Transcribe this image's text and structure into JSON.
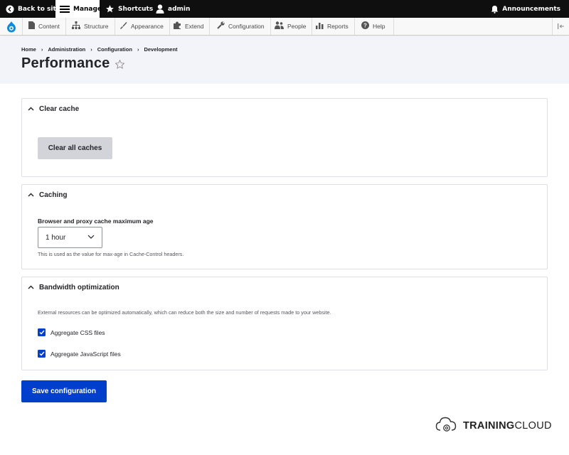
{
  "toolbar": {
    "back_to_site": "Back to site",
    "manage": "Manage",
    "shortcuts": "Shortcuts",
    "user": "admin",
    "announcements": "Announcements"
  },
  "admin_menu": {
    "content": "Content",
    "structure": "Structure",
    "appearance": "Appearance",
    "extend": "Extend",
    "configuration": "Configuration",
    "people": "People",
    "reports": "Reports",
    "help": "Help"
  },
  "breadcrumb": {
    "home": "Home",
    "administration": "Administration",
    "configuration": "Configuration",
    "development": "Development"
  },
  "page_title": "Performance",
  "clear_cache": {
    "heading": "Clear cache",
    "button": "Clear all caches"
  },
  "caching": {
    "heading": "Caching",
    "label": "Browser and proxy cache maximum age",
    "selected": "1 hour",
    "description": "This is used as the value for max-age in Cache-Control headers."
  },
  "bandwidth": {
    "heading": "Bandwidth optimization",
    "description": "External resources can be optimized automatically, which can reduce both the size and number of requests made to your website.",
    "css_label": "Aggregate CSS files",
    "css_checked": true,
    "js_label": "Aggregate JavaScript files",
    "js_checked": true
  },
  "save_button": "Save configuration",
  "brand": {
    "part1": "TRAINING",
    "part2": "CLOUD"
  },
  "colors": {
    "accent": "#003ecc",
    "toolbar": "#0f0f0f",
    "header_bg": "#f3f4f9"
  }
}
